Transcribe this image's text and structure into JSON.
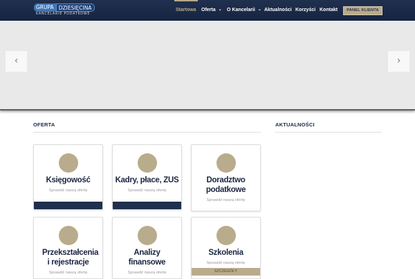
{
  "header": {
    "logo": {
      "left": "GRUPA",
      "right": "DZIESIĘCINA",
      "subtitle": "KANCELARIE PODATKOWE"
    },
    "nav": [
      {
        "label": "Startowa",
        "active": true
      },
      {
        "label": "Oferta",
        "has_dropdown": true
      },
      {
        "label": "O Kancelarii",
        "has_dropdown": true
      },
      {
        "label": "Aktualności"
      },
      {
        "label": "Korzyści"
      },
      {
        "label": "Kontakt"
      }
    ],
    "panel_button": "PANEL KLIENTA"
  },
  "slider": {
    "prev_icon": "chevron-left-icon",
    "next_icon": "chevron-right-icon"
  },
  "sections": {
    "offer_title": "OFERTA",
    "news_title": "AKTUALNOŚCI"
  },
  "cards": [
    {
      "title": "Księgowość",
      "link": "Sprawdź naszą ofertę"
    },
    {
      "title": "Kadry, płace, ZUS",
      "link": "Sprawdź naszą ofertę"
    },
    {
      "title": "Doradztwo podatkowe",
      "link": "Sprawdź naszą ofertę"
    },
    {
      "title": "Przekształcenia i rejestracje",
      "link": "Sprawdź naszą ofertę"
    },
    {
      "title": "Analizy finansowe",
      "link": "Sprawdź naszą ofertę"
    },
    {
      "title": "Szkolenia",
      "link": "Sprawdź naszą ofertę",
      "bar_label": "SZCZEGÓŁY"
    }
  ],
  "colors": {
    "navy": "#1f2f4e",
    "gold": "#b9ac8c",
    "header": "#1b2a47"
  }
}
